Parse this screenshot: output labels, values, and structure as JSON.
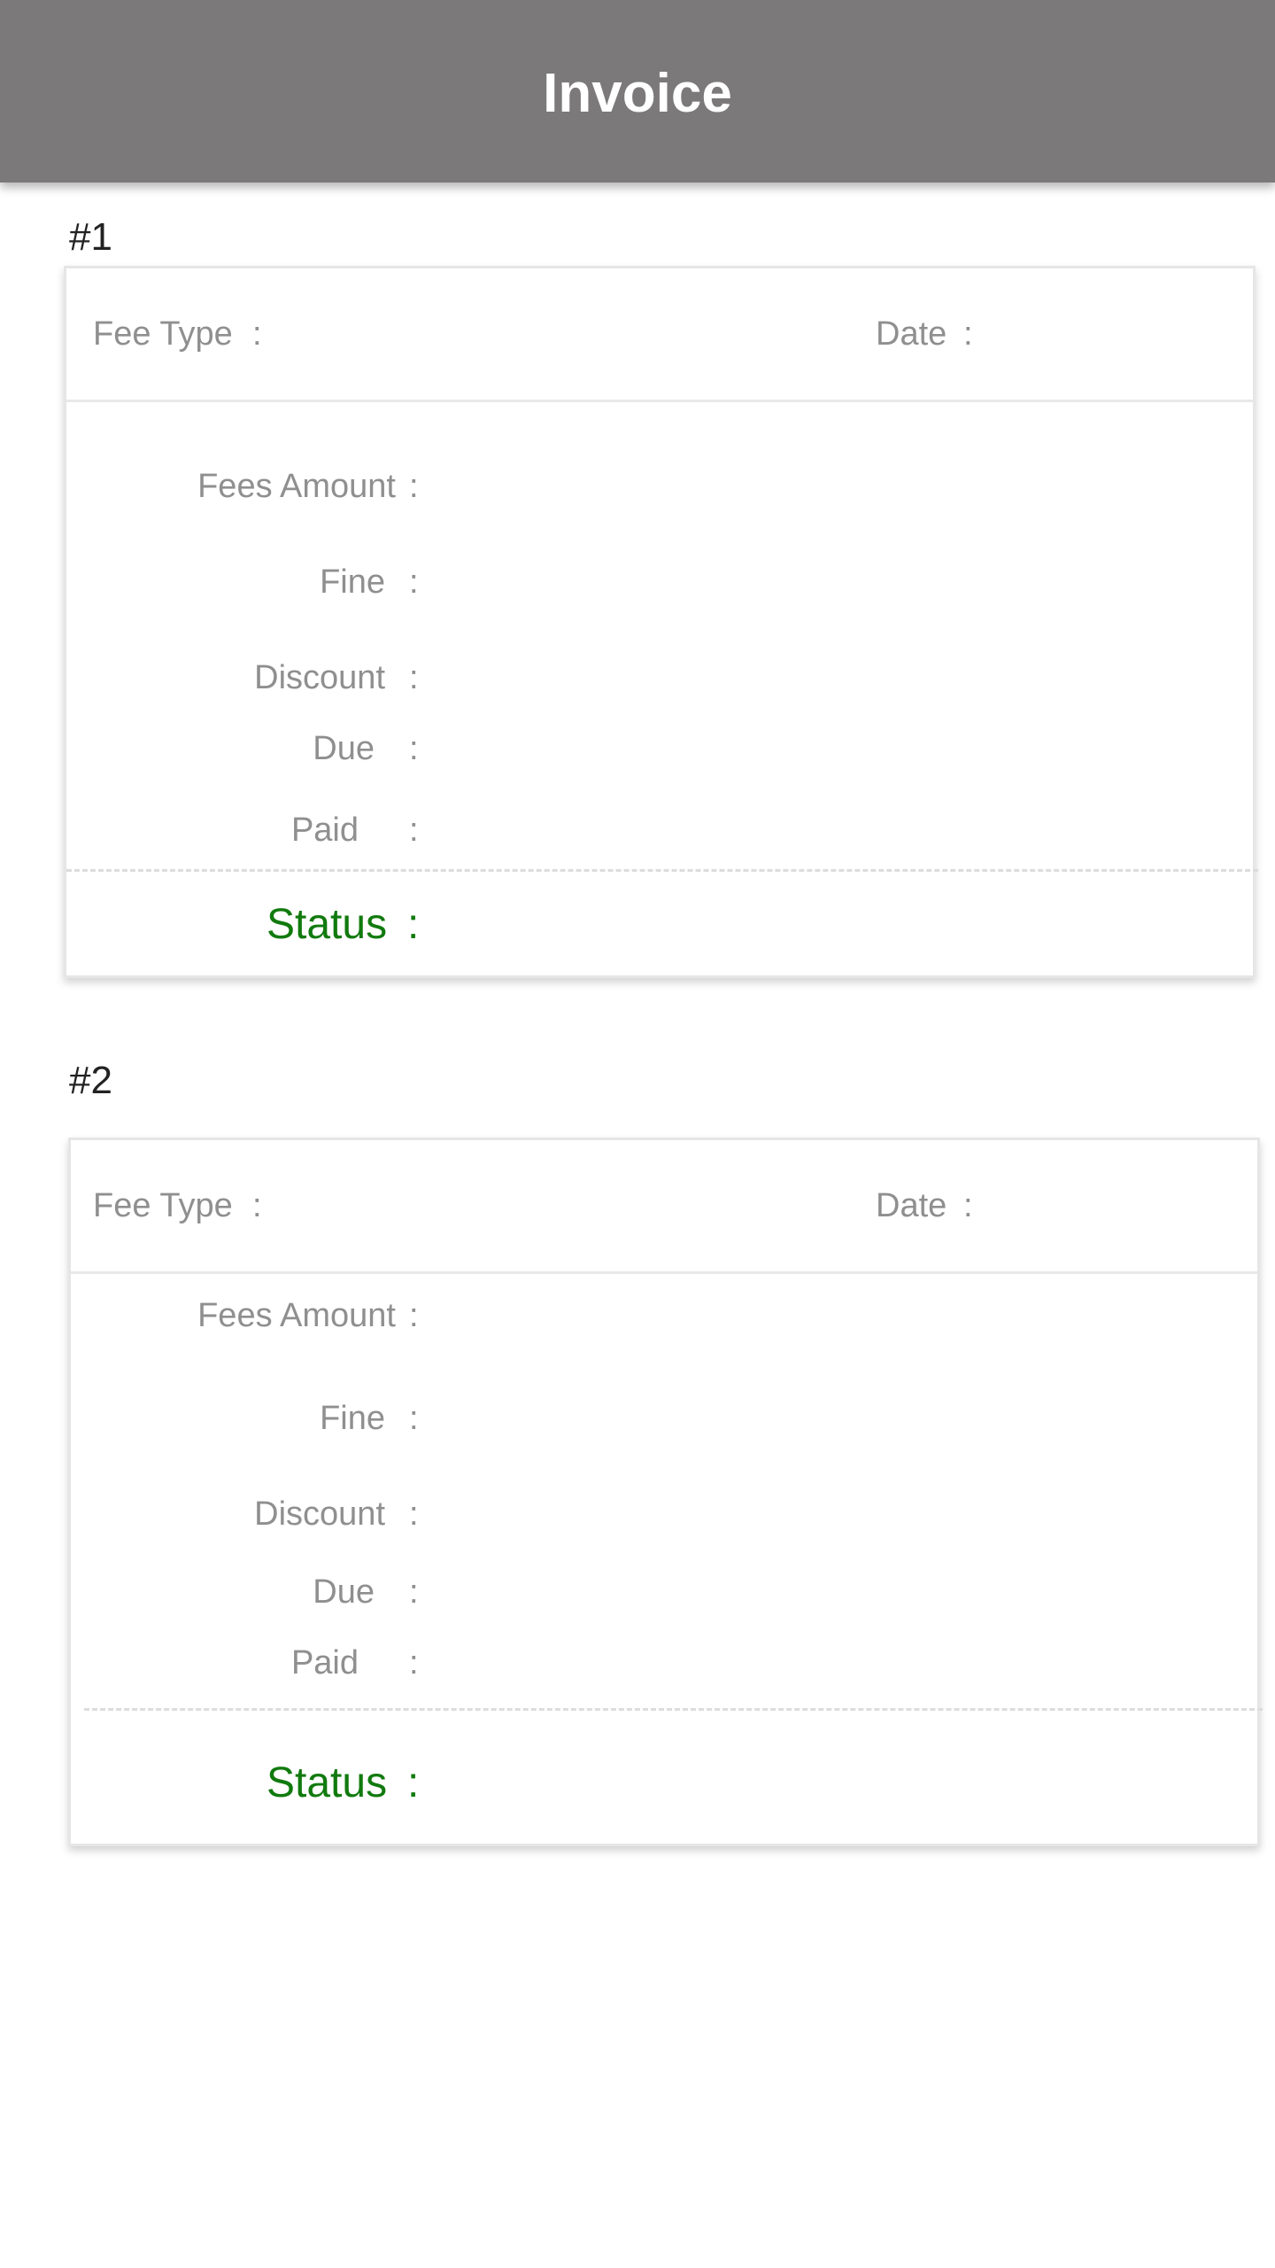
{
  "app_bar": {
    "title": "Invoice",
    "background_color": "#7b7979"
  },
  "invoices": [
    {
      "number": "#1",
      "fee_type_label": "Fee Type",
      "date_label": "Date",
      "fees_amount_label": "Fees Amount",
      "fine_label": "Fine",
      "discount_label": "Discount",
      "due_label": "Due",
      "paid_label": "Paid",
      "status_label": "Status",
      "colon": ":"
    },
    {
      "number": "#2",
      "fee_type_label": "Fee Type",
      "date_label": "Date",
      "fees_amount_label": "Fees Amount",
      "fine_label": "Fine",
      "discount_label": "Discount",
      "due_label": "Due",
      "paid_label": "Paid",
      "status_label": "Status",
      "colon": ":"
    }
  ],
  "colors": {
    "status_color": "#117a0e",
    "label_color": "#8f8f8f"
  }
}
